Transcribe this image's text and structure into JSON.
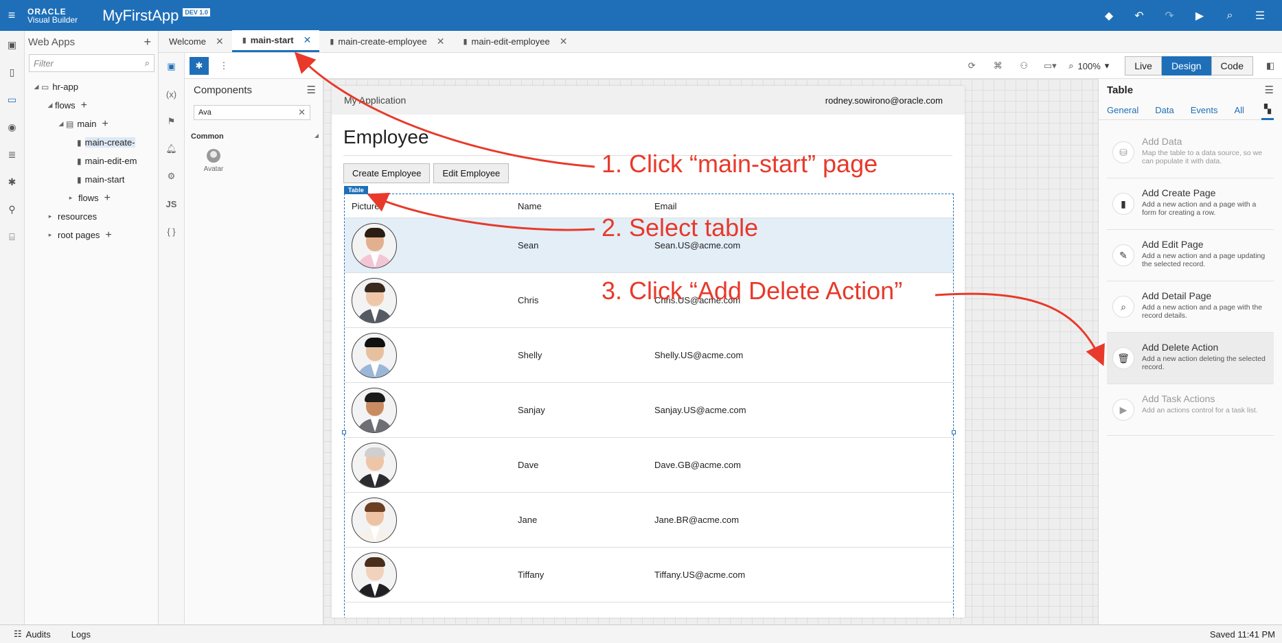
{
  "topbar": {
    "oracle_line1": "ORACLE",
    "oracle_line2": "Visual Builder",
    "app_name": "MyFirstApp",
    "version_badge": "DEV 1.0",
    "brand_color": "#1e6fb8"
  },
  "navigator": {
    "title": "Web Apps",
    "filter_placeholder": "Filter",
    "tree": [
      {
        "label": "hr-app"
      },
      {
        "label": "flows"
      },
      {
        "label": "main"
      },
      {
        "label": "main-create-"
      },
      {
        "label": "main-edit-em"
      },
      {
        "label": "main-start"
      },
      {
        "label": "flows"
      },
      {
        "label": "resources"
      },
      {
        "label": "root pages"
      }
    ]
  },
  "tabs": [
    {
      "label": "Welcome"
    },
    {
      "label": "main-start"
    },
    {
      "label": "main-create-employee"
    },
    {
      "label": "main-edit-employee"
    }
  ],
  "toolbar": {
    "zoom": "100%",
    "modes": [
      "Live",
      "Design",
      "Code"
    ],
    "active_mode": "Design"
  },
  "components": {
    "title": "Components",
    "search_value": "Ava",
    "category": "Common",
    "item": "Avatar"
  },
  "page": {
    "app_name": "My Application",
    "user_email": "rodney.sowirono@oracle.com",
    "title": "Employee",
    "buttons": [
      "Create Employee",
      "Edit Employee"
    ],
    "table_tag": "Table",
    "columns": [
      "Picture",
      "Name",
      "Email"
    ],
    "rows": [
      {
        "name": "Sean",
        "email": "Sean.US@acme.com",
        "selected": true
      },
      {
        "name": "Chris",
        "email": "Chris.US@acme.com"
      },
      {
        "name": "Shelly",
        "email": "Shelly.US@acme.com"
      },
      {
        "name": "Sanjay",
        "email": "Sanjay.US@acme.com"
      },
      {
        "name": "Dave",
        "email": "Dave.GB@acme.com"
      },
      {
        "name": "Jane",
        "email": "Jane.BR@acme.com"
      },
      {
        "name": "Tiffany",
        "email": "Tiffany.US@acme.com"
      }
    ]
  },
  "properties": {
    "title": "Table",
    "tabs": [
      "General",
      "Data",
      "Events",
      "All"
    ],
    "actions": [
      {
        "title": "Add Data",
        "desc": "Map the table to a data source, so we can populate it with data."
      },
      {
        "title": "Add Create Page",
        "desc": "Add a new action and a page with a form for creating a row."
      },
      {
        "title": "Add Edit Page",
        "desc": "Add a new action and a page updating the selected record."
      },
      {
        "title": "Add Detail Page",
        "desc": "Add a new action and a page with the record details."
      },
      {
        "title": "Add Delete Action",
        "desc": "Add a new action deleting the selected record."
      },
      {
        "title": "Add Task Actions",
        "desc": "Add an actions control for a task list."
      }
    ]
  },
  "statusbar": {
    "audits": "Audits",
    "logs": "Logs",
    "saved": "Saved 11:41 PM"
  },
  "annotations": {
    "step1": "1. Click “main-start” page",
    "step2": "2. Select table",
    "step3": "3. Click “Add Delete Action”",
    "color": "#e8392a"
  }
}
